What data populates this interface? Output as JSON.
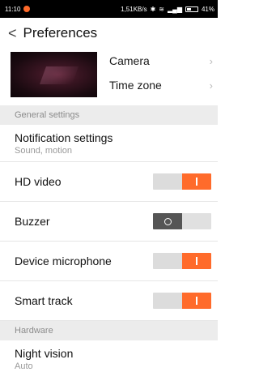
{
  "status_bar": {
    "time": "11:10",
    "network_speed": "1,51KB/s",
    "battery": "41%"
  },
  "app_bar": {
    "title": "Preferences"
  },
  "camera_section": {
    "links": [
      {
        "label": "Camera"
      },
      {
        "label": "Time zone"
      }
    ]
  },
  "general": {
    "header": "General settings",
    "notification": {
      "title": "Notification settings",
      "subtitle": "Sound, motion"
    },
    "toggles": [
      {
        "label": "HD video",
        "on": true
      },
      {
        "label": "Buzzer",
        "on": false
      },
      {
        "label": "Device microphone",
        "on": true
      },
      {
        "label": "Smart track",
        "on": true
      }
    ]
  },
  "hardware": {
    "header": "Hardware",
    "night_vision": {
      "title": "Night vision",
      "subtitle": "Auto"
    }
  },
  "colors": {
    "accent": "#ff6b2b",
    "section_bg": "#ececec",
    "off_dark": "#555555"
  }
}
